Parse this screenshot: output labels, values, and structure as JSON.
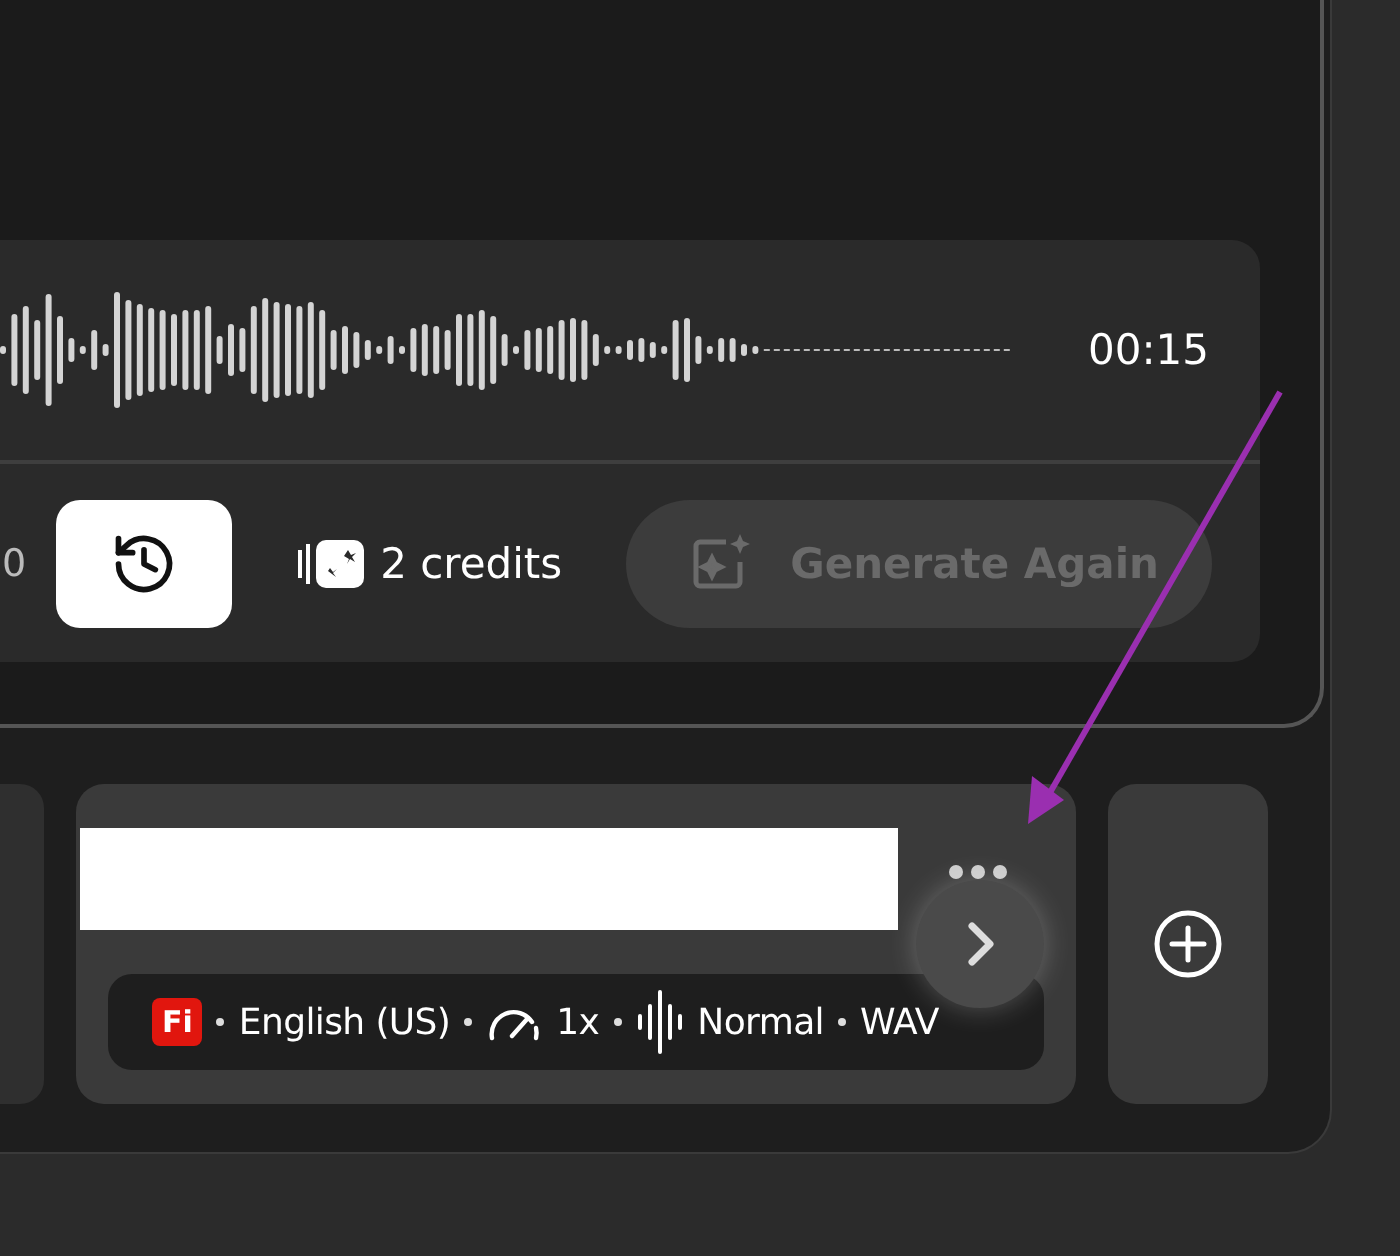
{
  "player": {
    "duration": "00:15",
    "counter": "0",
    "credits": "2 credits",
    "generate_button": {
      "label": "Generate Again",
      "disabled": true
    }
  },
  "voice_card": {
    "voice_badge": "Fi",
    "meta": [
      {
        "kind": "text",
        "label": "English (US)"
      },
      {
        "kind": "speed",
        "label": "1x"
      },
      {
        "kind": "tone",
        "label": "Normal"
      },
      {
        "kind": "text",
        "label": "WAV"
      }
    ]
  }
}
